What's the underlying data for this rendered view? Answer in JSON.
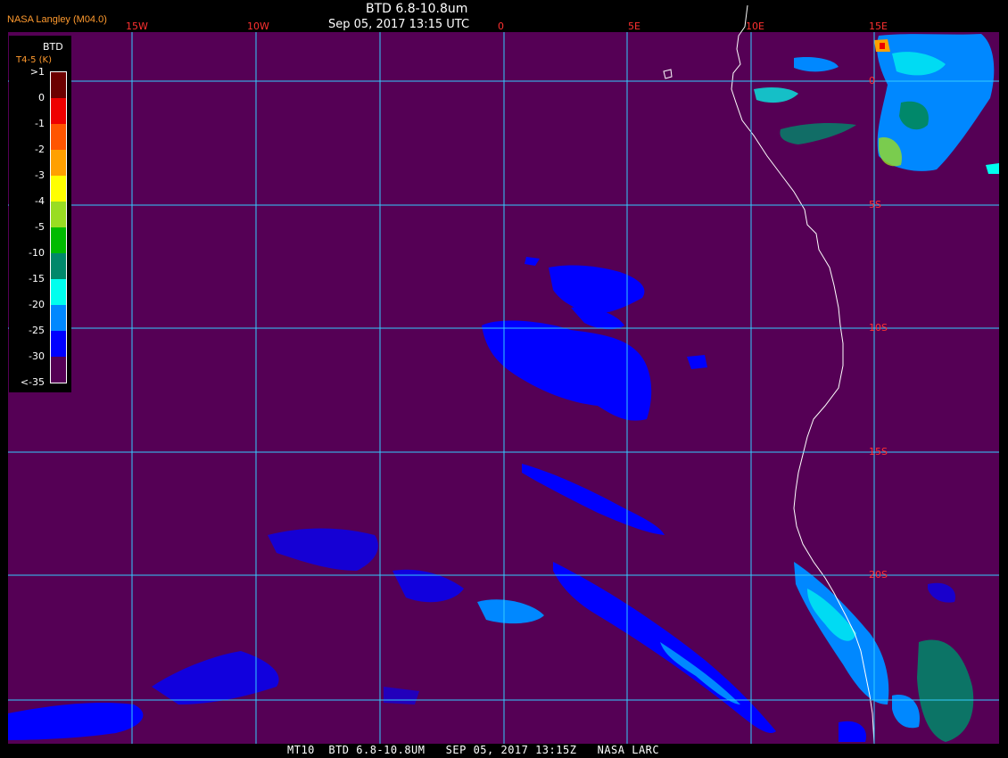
{
  "header": {
    "credit": "NASA Langley (M04.0)",
    "title": "BTD 6.8-10.8um",
    "datetime": "Sep 05, 2017 13:15 UTC"
  },
  "footer": {
    "text": "MT10  BTD 6.8-10.8UM   SEP 05, 2017 13:15Z   NASA LARC"
  },
  "legend": {
    "title": "BTD",
    "unit": "T4-5 (K)",
    "entries": [
      {
        "label": ">1",
        "color": "#6b0000"
      },
      {
        "label": "0",
        "color": "#ee0000"
      },
      {
        "label": "-1",
        "color": "#ff5500"
      },
      {
        "label": "-2",
        "color": "#ffa000"
      },
      {
        "label": "-3",
        "color": "#ffff00"
      },
      {
        "label": "-4",
        "color": "#99dd22"
      },
      {
        "label": "-5",
        "color": "#00bb00"
      },
      {
        "label": "-10",
        "color": "#00886a"
      },
      {
        "label": "-15",
        "color": "#00ffee"
      },
      {
        "label": "-20",
        "color": "#0088ff"
      },
      {
        "label": "-25",
        "color": "#0000ff"
      },
      {
        "label": "-30",
        "color": "#550055"
      },
      {
        "label": "<-35",
        "color": null
      }
    ]
  },
  "map": {
    "background": "#550055",
    "grid_color": "#33ccff",
    "coast_color": "#ffffff",
    "lon_labels": [
      "15W",
      "10W",
      "0",
      "5E",
      "10E",
      "15E"
    ],
    "lat_labels": [
      "0",
      "5S",
      "10S",
      "15S",
      "20S"
    ],
    "label_color": "#ff3030"
  }
}
